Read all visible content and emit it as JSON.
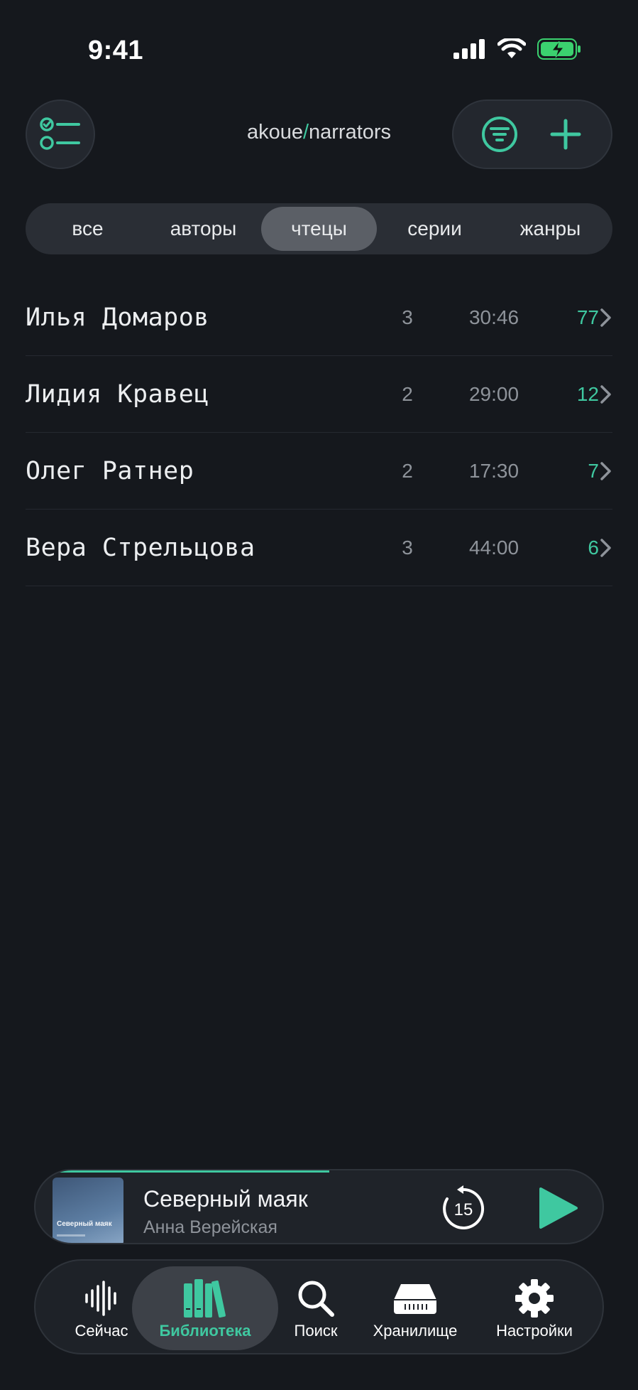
{
  "status": {
    "time": "9:41"
  },
  "header": {
    "breadcrumb_root": "akoue",
    "breadcrumb_sep": "/",
    "breadcrumb_leaf": "narrators"
  },
  "tabs": [
    {
      "label": "все"
    },
    {
      "label": "авторы"
    },
    {
      "label": "чтецы",
      "active": true
    },
    {
      "label": "серии"
    },
    {
      "label": "жанры"
    }
  ],
  "narrators": [
    {
      "name": "Илья Домаров",
      "count": "3",
      "duration": "30:46",
      "number": "77"
    },
    {
      "name": "Лидия Кравец",
      "count": "2",
      "duration": "29:00",
      "number": "12"
    },
    {
      "name": "Олег Ратнер",
      "count": "2",
      "duration": "17:30",
      "number": "7"
    },
    {
      "name": "Вера Стрельцова",
      "count": "3",
      "duration": "44:00",
      "number": "6"
    }
  ],
  "player": {
    "title": "Северный маяк",
    "author": "Анна Верейская",
    "cover_title": "Северный маяк",
    "rewind_seconds": "15",
    "progress": 0.47
  },
  "tabbar": [
    {
      "label": "Сейчас",
      "icon": "waveform-icon"
    },
    {
      "label": "Библиотека",
      "icon": "library-books-icon",
      "active": true
    },
    {
      "label": "Поиск",
      "icon": "magnifier-icon"
    },
    {
      "label": "Хранилище",
      "icon": "storage-drive-icon"
    },
    {
      "label": "Настройки",
      "icon": "gear-icon"
    }
  ],
  "colors": {
    "background": "#15181d",
    "accent": "#3fc8a0",
    "muted_text": "#8e939a"
  }
}
